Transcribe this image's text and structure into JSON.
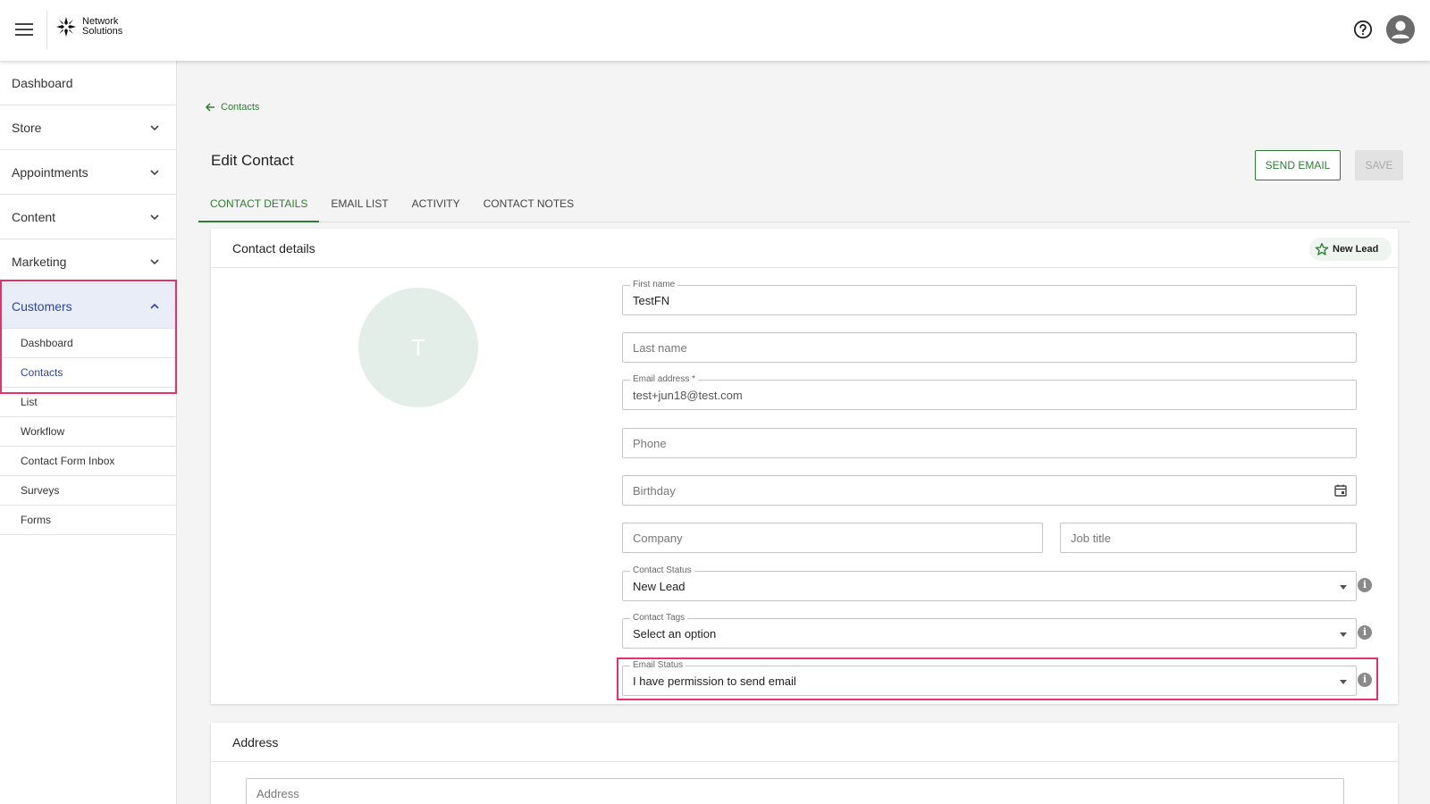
{
  "topbar": {
    "brand_line1": "Network",
    "brand_line2": "Solutions"
  },
  "sidebar": {
    "items": [
      {
        "label": "Dashboard"
      },
      {
        "label": "Store"
      },
      {
        "label": "Appointments"
      },
      {
        "label": "Content"
      },
      {
        "label": "Marketing"
      },
      {
        "label": "Customers"
      }
    ],
    "customers_sub": [
      {
        "label": "Dashboard"
      },
      {
        "label": "Contacts"
      },
      {
        "label": "List"
      },
      {
        "label": "Workflow"
      },
      {
        "label": "Contact Form Inbox"
      },
      {
        "label": "Surveys"
      },
      {
        "label": "Forms"
      }
    ]
  },
  "breadcrumb": {
    "back_label": "Contacts"
  },
  "page": {
    "title": "Edit Contact",
    "send_email_label": "SEND EMAIL",
    "save_label": "SAVE"
  },
  "tabs": [
    {
      "label": "CONTACT DETAILS",
      "active": true
    },
    {
      "label": "EMAIL LIST"
    },
    {
      "label": "ACTIVITY"
    },
    {
      "label": "CONTACT NOTES"
    }
  ],
  "contact_card": {
    "title": "Contact details",
    "lead_chip": "New Lead",
    "avatar_initial": "T",
    "fields": {
      "first_name": {
        "label": "First name",
        "value": "TestFN"
      },
      "last_name": {
        "placeholder": "Last name"
      },
      "email": {
        "label": "Email address *",
        "value": "test+jun18@test.com"
      },
      "phone": {
        "placeholder": "Phone"
      },
      "birthday": {
        "placeholder": "Birthday"
      },
      "company": {
        "placeholder": "Company"
      },
      "job_title": {
        "placeholder": "Job title"
      },
      "contact_status": {
        "label": "Contact Status",
        "value": "New Lead"
      },
      "contact_tags": {
        "label": "Contact Tags",
        "value": "Select an option"
      },
      "email_status": {
        "label": "Email Status",
        "value": "I have permission to send email"
      }
    }
  },
  "address_card": {
    "title": "Address",
    "address_placeholder": "Address"
  },
  "colors": {
    "accent_green": "#2e7d32",
    "active_nav_blue": "#2b45a6",
    "highlight_pink": "#e8306f"
  }
}
